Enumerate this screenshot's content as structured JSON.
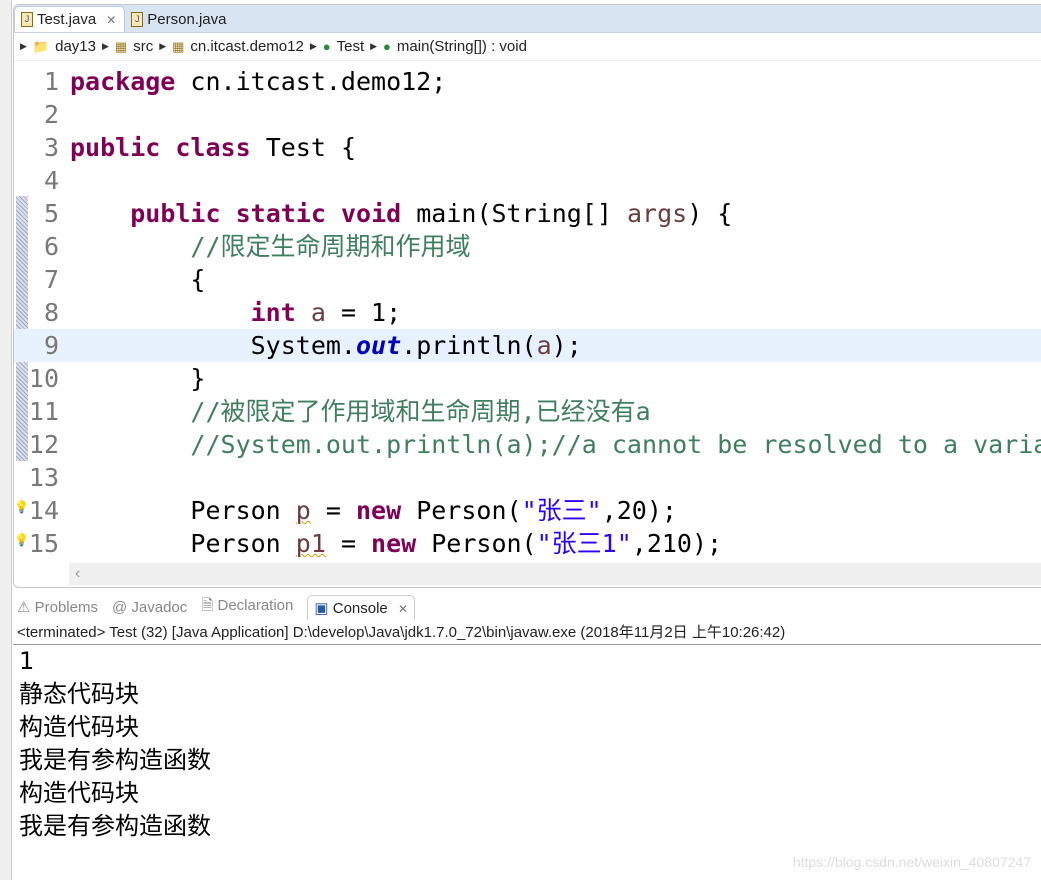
{
  "tabs": [
    {
      "label": "Test.java",
      "active": true
    },
    {
      "label": "Person.java",
      "active": false
    }
  ],
  "breadcrumb": [
    "day13",
    "src",
    "cn.itcast.demo12",
    "Test",
    "main(String[]) : void"
  ],
  "code": [
    {
      "n": "1",
      "html": "<span class='kw'>package</span> cn.itcast.demo12;"
    },
    {
      "n": "2",
      "html": ""
    },
    {
      "n": "3",
      "html": "<span class='kw'>public</span> <span class='kw'>class</span> Test {"
    },
    {
      "n": "4",
      "html": ""
    },
    {
      "n": "5",
      "html": "    <span class='kw'>public</span> <span class='kw'>static</span> <span class='kw'>void</span> main(String[] <span class='var'>args</span>) {"
    },
    {
      "n": "6",
      "html": "        <span class='cm'>//限定生命周期和作用域</span>"
    },
    {
      "n": "7",
      "html": "        {"
    },
    {
      "n": "8",
      "html": "            <span class='kw'>int</span> <span class='var'>a</span> = 1;"
    },
    {
      "n": "9",
      "html": "            System.<span class='fld'>out</span>.println(<span class='var'>a</span>);"
    },
    {
      "n": "10",
      "html": "        }"
    },
    {
      "n": "11",
      "html": "        <span class='cm'>//被限定了作用域和生命周期,已经没有a</span>"
    },
    {
      "n": "12",
      "html": "        <span class='cm'>//System.out.println(a);//a cannot be resolved to a variable</span>"
    },
    {
      "n": "13",
      "html": ""
    },
    {
      "n": "14",
      "html": "        Person <span class='var warn'>p</span> = <span class='kw'>new</span> Person(<span class='st'>\"张三\"</span>,20);"
    },
    {
      "n": "15",
      "html": "        Person <span class='var warn'>p1</span> = <span class='kw'>new</span> Person(<span class='st'>\"张三1\"</span>,210);"
    }
  ],
  "current_line": 9,
  "bottom_tabs": [
    {
      "label": "Problems"
    },
    {
      "label": "Javadoc"
    },
    {
      "label": "Declaration"
    },
    {
      "label": "Console",
      "active": true
    }
  ],
  "console_status": "<terminated> Test (32) [Java Application] D:\\develop\\Java\\jdk1.7.0_72\\bin\\javaw.exe (2018年11月2日 上午10:26:42)",
  "console_output": [
    "1",
    "静态代码块",
    "构造代码块",
    "我是有参构造函数",
    "构造代码块",
    "我是有参构造函数"
  ],
  "watermark": "https://blog.csdn.net/weixin_40807247"
}
